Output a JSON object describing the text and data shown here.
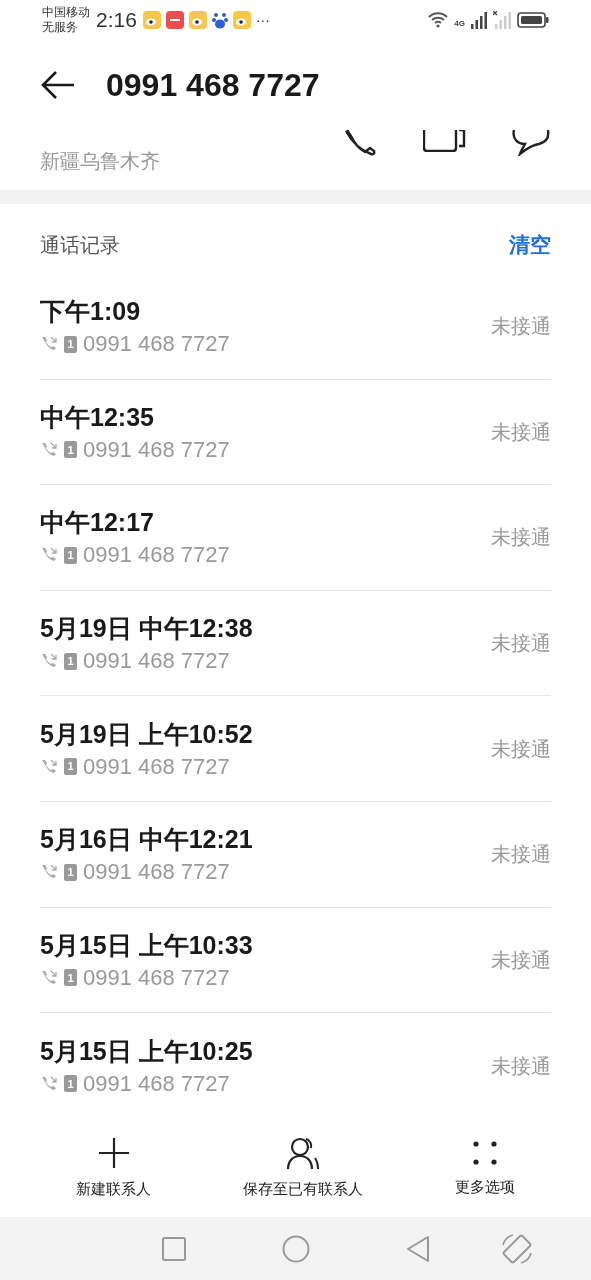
{
  "status_bar": {
    "carrier": "中国移动",
    "service": "无服务",
    "time": "2:16",
    "more": "···",
    "network": "4G"
  },
  "header": {
    "title": "0991 468 7727",
    "location": "新疆乌鲁木齐"
  },
  "call_log": {
    "title": "通话记录",
    "clear": "清空",
    "rows": [
      {
        "time": "下午1:09",
        "number": "0991 468 7727",
        "sim": "1",
        "status": "未接通"
      },
      {
        "time": "中午12:35",
        "number": "0991 468 7727",
        "sim": "1",
        "status": "未接通"
      },
      {
        "time": "中午12:17",
        "number": "0991 468 7727",
        "sim": "1",
        "status": "未接通"
      },
      {
        "time": "5月19日 中午12:38",
        "number": "0991 468 7727",
        "sim": "1",
        "status": "未接通"
      },
      {
        "time": "5月19日 上午10:52",
        "number": "0991 468 7727",
        "sim": "1",
        "status": "未接通"
      },
      {
        "time": "5月16日 中午12:21",
        "number": "0991 468 7727",
        "sim": "1",
        "status": "未接通"
      },
      {
        "time": "5月15日 上午10:33",
        "number": "0991 468 7727",
        "sim": "1",
        "status": "未接通"
      },
      {
        "time": "5月15日 上午10:25",
        "number": "0991 468 7727",
        "sim": "1",
        "status": "未接通"
      }
    ]
  },
  "actions": [
    {
      "kind": "add",
      "label": "新建联系人"
    },
    {
      "kind": "person",
      "label": "保存至已有联系人"
    },
    {
      "kind": "more",
      "label": "更多选项"
    }
  ]
}
